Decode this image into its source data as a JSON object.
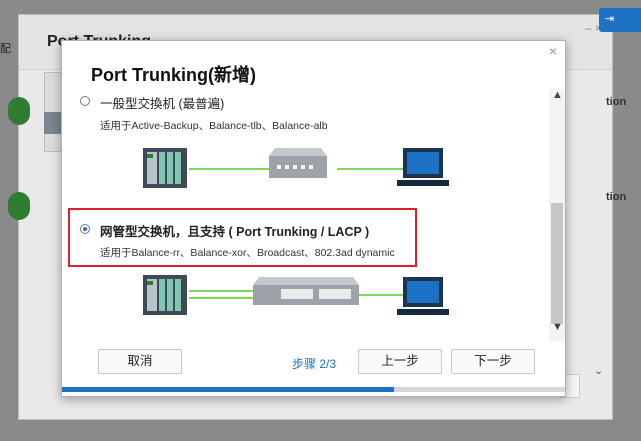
{
  "background": {
    "window_title": "Port Trunking",
    "left_label": "配",
    "right_label_1": "tion",
    "right_label_2": "tion",
    "corner_button": "",
    "window_controls": "– ×"
  },
  "dialog": {
    "title": "Port Trunking(新增)",
    "close_symbol": "×",
    "options": [
      {
        "title": "一般型交換机 (最普遍)",
        "description": "适用于Active-Backup、Balance-tlb、Balance-alb",
        "selected": false
      },
      {
        "title": "网管型交换机，且支持 ( Port Trunking / LACP )",
        "description": "适用于Balance-rr、Balance-xor、Broadcast、802.3ad dynamic",
        "selected": true
      }
    ],
    "buttons": {
      "cancel": "取消",
      "previous": "上一步",
      "next": "下一步"
    },
    "step_label": "步骤 2/3",
    "progress": 0.66,
    "scroll_up": "▲",
    "scroll_down": "▼",
    "colors": {
      "accent": "#1e72c6",
      "highlight_border": "#d8212b",
      "link_line": "#7ed957"
    }
  }
}
